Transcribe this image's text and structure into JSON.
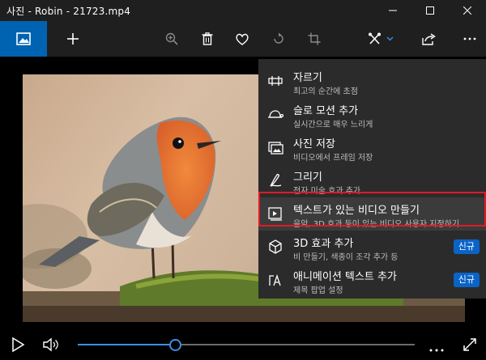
{
  "window": {
    "title": "사진 - Robin - 21723.mp4"
  },
  "menu": {
    "items": [
      {
        "title": "자르기",
        "subtitle": "최고의 순간에 초점",
        "icon": "trim-icon"
      },
      {
        "title": "슬로 모션 추가",
        "subtitle": "실시간으로 매우 느리게",
        "icon": "turtle-icon"
      },
      {
        "title": "사진 저장",
        "subtitle": "비디오에서 프레임 저장",
        "icon": "save-frame-icon"
      },
      {
        "title": "그리기",
        "subtitle": "전자 미술 효과 추가",
        "icon": "draw-icon"
      },
      {
        "title": "텍스트가 있는 비디오 만들기",
        "subtitle": "음악, 3D 효과 등이 있는 비디오 사용자 지정하기",
        "icon": "video-text-icon",
        "highlighted": true
      },
      {
        "title": "3D 효과 추가",
        "subtitle": "비 만들기, 색종이 조각 추가 등",
        "icon": "3d-effects-icon",
        "badge": "신규"
      },
      {
        "title": "애니메이션 텍스트 추가",
        "subtitle": "제목 팝업 설정",
        "icon": "animated-text-icon",
        "badge": "신규"
      }
    ]
  },
  "playback": {
    "progress": 0.286
  },
  "colors": {
    "accent": "#0063b1",
    "highlight_border": "#e01b24",
    "badge": "#0a64c8",
    "seek": "#3b8fe6"
  }
}
